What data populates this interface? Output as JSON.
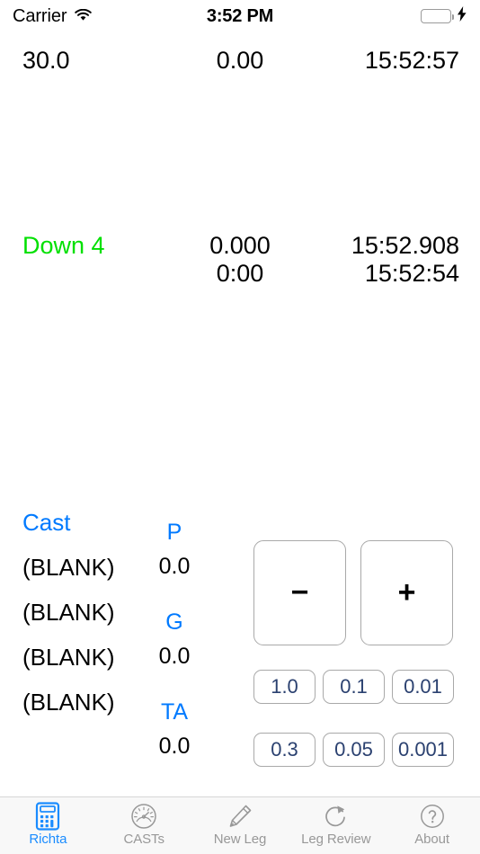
{
  "status_bar": {
    "carrier": "Carrier",
    "wifi_icon": "wifi-icon",
    "time": "3:52 PM",
    "battery_icon": "battery-icon",
    "charging_icon": "lightning-bolt-icon"
  },
  "top_row": {
    "speed": "30.0",
    "distance": "0.00",
    "clock": "15:52:57"
  },
  "leg_row": {
    "leg_label": "Down 4",
    "distance": "0.000",
    "time": "15:52.908",
    "elapsed": "0:00",
    "clock": "15:52:54"
  },
  "cast_panel": {
    "heading": "Cast",
    "rows": [
      {
        "name": "(BLANK)"
      },
      {
        "name": "(BLANK)"
      },
      {
        "name": "(BLANK)"
      },
      {
        "name": "(BLANK)"
      }
    ],
    "params": [
      {
        "tag": "P",
        "value": "0.0"
      },
      {
        "tag": "G",
        "value": "0.0"
      },
      {
        "tag": "TA",
        "value": "0.0"
      }
    ]
  },
  "adjust_controls": {
    "minus_label": "−",
    "plus_label": "+",
    "increments": [
      [
        "1.0",
        "0.1",
        "0.01"
      ],
      [
        "0.3",
        "0.05",
        "0.001"
      ]
    ]
  },
  "tab_bar": {
    "items": [
      {
        "label": "Richta",
        "icon": "calculator-icon",
        "active": true
      },
      {
        "label": "CASTs",
        "icon": "gauge-icon",
        "active": false
      },
      {
        "label": "New Leg",
        "icon": "pencil-icon",
        "active": false
      },
      {
        "label": "Leg Review",
        "icon": "refresh-icon",
        "active": false
      },
      {
        "label": "About",
        "icon": "question-circle-icon",
        "active": false
      }
    ]
  },
  "colors": {
    "accent_blue": "#007AFF",
    "tab_active_blue": "#1A8CFF",
    "leg_green": "#00E000",
    "increment_navy": "#2B4170",
    "battery_green": "#4CD964",
    "inactive_gray": "#989898"
  }
}
